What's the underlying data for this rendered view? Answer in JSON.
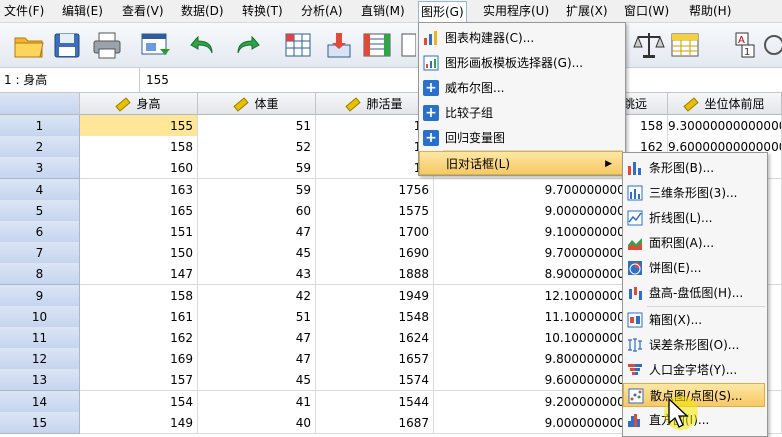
{
  "menubar": {
    "items": [
      "文件(F)",
      "编辑(E)",
      "查看(V)",
      "数据(D)",
      "转换(T)",
      "分析(A)",
      "直销(M)",
      "图形(G)",
      "实用程序(U)",
      "扩展(X)",
      "窗口(W)",
      "帮助(H)"
    ],
    "active": "图形(G)"
  },
  "cell_editor": {
    "reference": "1 : 身高",
    "value": "155"
  },
  "grid": {
    "columns": [
      "身高",
      "体重",
      "肺活量",
      "跳远",
      "坐位体前屈"
    ],
    "rows": [
      {
        "n": "1",
        "h": "155",
        "w": "51",
        "v": "16",
        "j": "158",
        "s": "9.30000000000000"
      },
      {
        "n": "2",
        "h": "158",
        "w": "52",
        "v": "18",
        "j": "162",
        "s": "9.60000000000000"
      },
      {
        "n": "3",
        "h": "160",
        "w": "59",
        "v": "19",
        "j": "",
        "s": ""
      },
      {
        "n": "4",
        "h": "163",
        "w": "59",
        "v": "1756",
        "j": "9.70000000000000",
        "s": ""
      },
      {
        "n": "5",
        "h": "165",
        "w": "60",
        "v": "1575",
        "j": "9.00000000000000",
        "s": ""
      },
      {
        "n": "6",
        "h": "151",
        "w": "47",
        "v": "1700",
        "j": "9.10000000000000",
        "s": ""
      },
      {
        "n": "7",
        "h": "150",
        "w": "45",
        "v": "1690",
        "j": "9.70000000000000",
        "s": ""
      },
      {
        "n": "8",
        "h": "147",
        "w": "43",
        "v": "1888",
        "j": "8.90000000000000",
        "s": ""
      },
      {
        "n": "9",
        "h": "158",
        "w": "42",
        "v": "1949",
        "j": "12.1000000000000",
        "s": ""
      },
      {
        "n": "10",
        "h": "161",
        "w": "51",
        "v": "1548",
        "j": "11.1000000000000",
        "s": ""
      },
      {
        "n": "11",
        "h": "162",
        "w": "47",
        "v": "1624",
        "j": "10.1000000000000",
        "s": ""
      },
      {
        "n": "12",
        "h": "169",
        "w": "47",
        "v": "1657",
        "j": "9.80000000000000",
        "s": ""
      },
      {
        "n": "13",
        "h": "157",
        "w": "45",
        "v": "1574",
        "j": "9.60000000000000",
        "s": ""
      },
      {
        "n": "14",
        "h": "154",
        "w": "41",
        "v": "1544",
        "j": "9.20000000000000",
        "s": ""
      },
      {
        "n": "15",
        "h": "149",
        "w": "40",
        "v": "1687",
        "j": "9.00000000000000",
        "s": ""
      }
    ]
  },
  "graph_menu": {
    "items": [
      "图表构建器(C)...",
      "图形画板模板选择器(G)...",
      "威布尔图...",
      "比较子组",
      "回归变量图",
      "旧对话框(L)"
    ],
    "icons": [
      "chart-builder-icon",
      "template-icon",
      "plus-icon",
      "plus-icon",
      "plus-icon",
      ""
    ]
  },
  "legacy_submenu": {
    "items": [
      "条形图(B)...",
      "三维条形图(3)...",
      "折线图(L)...",
      "面积图(A)...",
      "饼图(E)...",
      "盘高-盘低图(H)...",
      "箱图(X)...",
      "误差条形图(O)...",
      "人口金字塔(Y)...",
      "散点图/点图(S)...",
      "直方图(I)..."
    ],
    "highlighted": "散点图/点图(S)..."
  },
  "colors": {
    "highlight": "#f6c964",
    "selected_cell": "#ffe698",
    "row_header": "#c6d5ee"
  }
}
